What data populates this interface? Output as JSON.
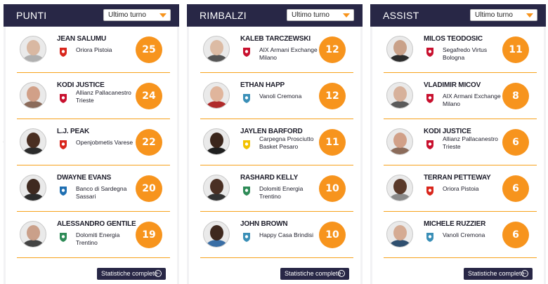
{
  "nav": {
    "prev_icon": "chevron-left-icon",
    "next_icon": "chevron-right-icon",
    "prev_glyph": "‹",
    "next_glyph": "›"
  },
  "accent": "#f7941d",
  "header_bg": "#282746",
  "panels": [
    {
      "title": "PUNTI",
      "filter": "Ultimo turno",
      "more": "Statistiche complete",
      "players": [
        {
          "name": "JEAN SALUMU",
          "team": "Oriora Pistoia",
          "value": "25",
          "skin": "#d9b8a2",
          "shirt": "#b0b0b0",
          "logo": "#d9261c"
        },
        {
          "name": "KODI JUSTICE",
          "team": "Allianz Pallacanestro Trieste",
          "value": "24",
          "skin": "#d1a088",
          "shirt": "#8b6b5a",
          "logo": "#c8102e"
        },
        {
          "name": "L.J. PEAK",
          "team": "Openjobmetis Varese",
          "value": "22",
          "skin": "#4a2f22",
          "shirt": "#2b2b2b",
          "logo": "#d9261c"
        },
        {
          "name": "DWAYNE EVANS",
          "team": "Banco di Sardegna Sassari",
          "value": "20",
          "skin": "#3f2a20",
          "shirt": "#2c2c2c",
          "logo": "#1f6fb2"
        },
        {
          "name": "ALESSANDRO GENTILE",
          "team": "Dolomiti Energia Trentino",
          "value": "19",
          "skin": "#caa08a",
          "shirt": "#444444",
          "logo": "#2e8b57"
        }
      ]
    },
    {
      "title": "RIMBALZI",
      "filter": "Ultimo turno",
      "more": "Statistiche complete",
      "players": [
        {
          "name": "KALEB TARCZEWSKI",
          "team": "AIX Armani Exchange Milano",
          "value": "12",
          "skin": "#dcbba4",
          "shirt": "#555555",
          "logo": "#c8102e"
        },
        {
          "name": "ETHAN HAPP",
          "team": "Vanoli Cremona",
          "value": "12",
          "skin": "#e0b59c",
          "shirt": "#b02a2a",
          "logo": "#3a8fb7"
        },
        {
          "name": "JAYLEN BARFORD",
          "team": "Carpegna Prosciutto Basket Pesaro",
          "value": "11",
          "skin": "#3b261c",
          "shirt": "#1f1f1f",
          "logo": "#f2c200"
        },
        {
          "name": "RASHARD KELLY",
          "team": "Dolomiti Energia Trentino",
          "value": "10",
          "skin": "#4a3024",
          "shirt": "#333333",
          "logo": "#2e8b57"
        },
        {
          "name": "JOHN BROWN",
          "team": "Happy Casa Brindisi",
          "value": "10",
          "skin": "#3e281e",
          "shirt": "#3a6ea5",
          "logo": "#3a8fb7"
        }
      ]
    },
    {
      "title": "ASSIST",
      "filter": "Ultimo turno",
      "more": "Statistiche complete",
      "players": [
        {
          "name": "MILOS TEODOSIC",
          "team": "Segafredo Virtus Bologna",
          "value": "11",
          "skin": "#c9a189",
          "shirt": "#2b2b2b",
          "logo": "#c8102e"
        },
        {
          "name": "VLADIMIR MICOV",
          "team": "AIX Armani Exchange Milano",
          "value": "8",
          "skin": "#d7b19b",
          "shirt": "#5a5a5a",
          "logo": "#c8102e"
        },
        {
          "name": "KODI JUSTICE",
          "team": "Allianz Pallacanestro Trieste",
          "value": "6",
          "skin": "#d1a088",
          "shirt": "#8b6b5a",
          "logo": "#c8102e"
        },
        {
          "name": "TERRAN PETTEWAY",
          "team": "Oriora Pistoia",
          "value": "6",
          "skin": "#5a3a2a",
          "shirt": "#8a8a8a",
          "logo": "#d9261c"
        },
        {
          "name": "MICHELE RUZZIER",
          "team": "Vanoli Cremona",
          "value": "6",
          "skin": "#d5ab93",
          "shirt": "#2f4f6f",
          "logo": "#3a8fb7"
        }
      ]
    }
  ]
}
